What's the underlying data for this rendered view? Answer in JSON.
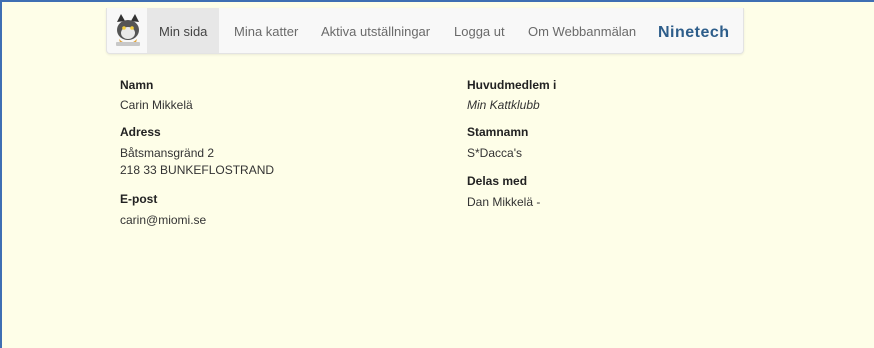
{
  "nav": {
    "items": [
      {
        "label": "Min sida",
        "active": true
      },
      {
        "label": "Mina katter",
        "active": false
      },
      {
        "label": "Aktiva utställningar",
        "active": false
      },
      {
        "label": "Logga ut",
        "active": false
      },
      {
        "label": "Om Webbanmälan",
        "active": false
      }
    ],
    "brand": "Ninetech",
    "logo_icon": "cat-mascot-icon"
  },
  "profile": {
    "name_label": "Namn",
    "name_value": "Carin Mikkelä",
    "address_label": "Adress",
    "address_line1": "Båtsmansgränd 2",
    "address_line2": "218 33 BUNKEFLOSTRAND",
    "email_label": "E-post",
    "email_value": "carin@miomi.se",
    "club_label": "Huvudmedlem i",
    "club_value": "Min Kattklubb",
    "cattery_label": "Stamnamn",
    "cattery_value": "S*Dacca's",
    "shared_label": "Delas med",
    "shared_value": "Dan Mikkelä -"
  },
  "colors": {
    "page_background": "#fefee8",
    "frame": "#3f6fb3",
    "brand": "#2d5d8a"
  }
}
